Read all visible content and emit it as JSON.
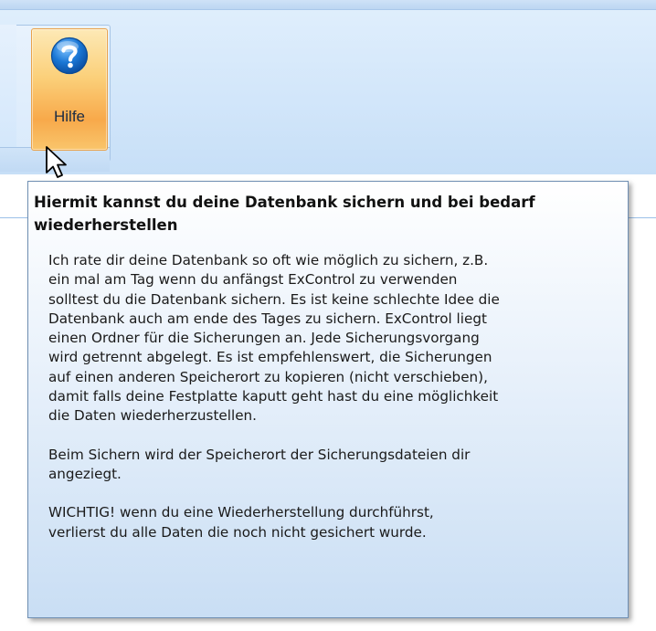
{
  "ribbon": {
    "help_button_label": "Hilfe",
    "help_icon": "question-mark-icon",
    "accent_color": "#f8a94a"
  },
  "tooltip": {
    "title": "Hiermit kannst du deine Datenbank sichern und bei bedarf wiederherstellen",
    "paragraphs": [
      "Ich rate dir deine Datenbank so oft wie möglich zu sichern, z.B.\nein mal am Tag wenn du anfängst ExControl zu verwenden\nsolltest du die Datenbank sichern. Es ist keine schlechte Idee die\nDatenbank auch am ende des Tages zu sichern. ExControl liegt\neinen Ordner für die Sicherungen an. Jede Sicherungsvorgang\nwird getrennt abgelegt. Es ist empfehlenswert, die Sicherungen\nauf einen anderen Speicherort zu kopieren (nicht verschieben),\ndamit falls deine Festplatte kaputt geht hast du eine möglichkeit\ndie Daten wiederherzustellen.",
      "Beim Sichern wird der Speicherort der Sicherungsdateien dir\nangeziegt.",
      "WICHTIG! wenn du eine Wiederherstellung durchführst,\nverlierst du alle Daten die noch nicht gesichert wurde."
    ]
  }
}
